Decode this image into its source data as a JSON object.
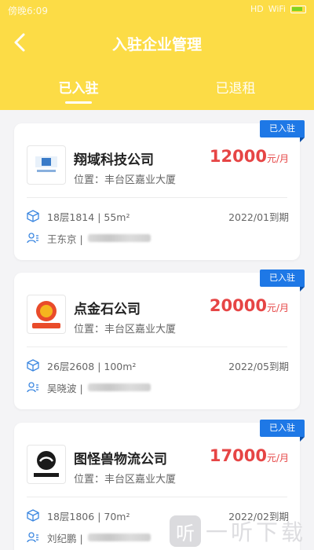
{
  "status": {
    "time": "傍晚6:09",
    "wifi": "WiFi",
    "signal": "HD"
  },
  "nav": {
    "title": "入驻企业管理"
  },
  "tabs": [
    {
      "label": "已入驻"
    },
    {
      "label": "已退租"
    }
  ],
  "cards": [
    {
      "badge": "已入驻",
      "name": "翔域科技公司",
      "location": "位置：丰台区嘉业大厦",
      "price": "12000",
      "unit": "元/月",
      "room": "18层1814 | 55m²",
      "due": "2022/01到期",
      "contact": "王东京 |"
    },
    {
      "badge": "已入驻",
      "name": "点金石公司",
      "location": "位置：丰台区嘉业大厦",
      "price": "20000",
      "unit": "元/月",
      "room": "26层2608 | 100m²",
      "due": "2022/05到期",
      "contact": "吴晓波 |"
    },
    {
      "badge": "已入驻",
      "name": "图怪兽物流公司",
      "location": "位置：丰台区嘉业大厦",
      "price": "17000",
      "unit": "元/月",
      "room": "18层1806 | 70m²",
      "due": "2022/02到期",
      "contact": "刘纪鹏 |"
    }
  ],
  "watermark": {
    "text": "一听下载",
    "icon": "听"
  },
  "colors": {
    "header": "#fcdc46",
    "price": "#e64545",
    "badge": "#1e78e6"
  }
}
